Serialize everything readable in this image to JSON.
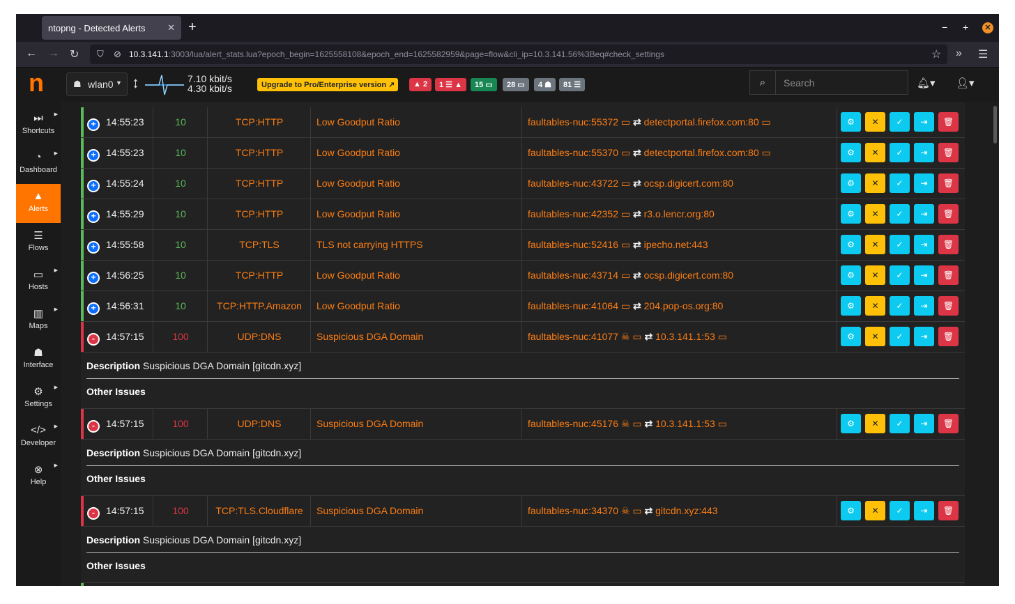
{
  "browser": {
    "tab_title": "ntopng - Detected Alerts",
    "tab_close": "✕",
    "new_tab": "+",
    "url_host": "10.3.141.1",
    "url_rest": ":3003/lua/alert_stats.lua?epoch_begin=1625558108&epoch_end=1625582959&page=flow&cli_ip=10.3.141.56%3Beq#check_settings",
    "win_min": "−",
    "win_max": "+",
    "win_close": "✕"
  },
  "header": {
    "logo": "n",
    "interface_label": "wlan0",
    "rate_up": "7.10 kbit/s",
    "rate_down": "4.30 kbit/s",
    "upgrade_label": "Upgrade to Pro/Enterprise version ↗",
    "badges": [
      {
        "label": "▲ 2",
        "color": "#dc3545"
      },
      {
        "label": "1 ☰ ▲",
        "color": "#dc3545"
      },
      {
        "label": "15 ▭",
        "color": "#198754"
      },
      {
        "label": "28 ▭",
        "color": "#6c757d"
      },
      {
        "label": "4 ☗",
        "color": "#6c757d"
      },
      {
        "label": "81 ☰",
        "color": "#6c757d"
      }
    ],
    "search_placeholder": "Search"
  },
  "sidebar": {
    "items": [
      {
        "label": "Shortcuts",
        "icon": "⏭",
        "active": false,
        "caret": true
      },
      {
        "label": "Dashboard",
        "icon": "◔",
        "active": false,
        "caret": true
      },
      {
        "label": "Alerts",
        "icon": "▲",
        "active": true,
        "caret": false
      },
      {
        "label": "Flows",
        "icon": "☰",
        "active": false,
        "caret": false
      },
      {
        "label": "Hosts",
        "icon": "▭",
        "active": false,
        "caret": true
      },
      {
        "label": "Maps",
        "icon": "▥",
        "active": false,
        "caret": true
      },
      {
        "label": "Interface",
        "icon": "☗",
        "active": false,
        "caret": false
      },
      {
        "label": "Settings",
        "icon": "⚙",
        "active": false,
        "caret": true
      },
      {
        "label": "Developer",
        "icon": "</>",
        "active": false,
        "caret": true
      },
      {
        "label": "Help",
        "icon": "⊗",
        "active": false,
        "caret": true
      }
    ]
  },
  "alerts": {
    "rows": [
      {
        "toggle": "+",
        "time": "14:55:23",
        "score": "10",
        "proto": "TCP:HTTP",
        "alert": "Low Goodput Ratio",
        "client": "faultables-nuc:55372",
        "client_skull": false,
        "server": "detectportal.firefox.com:80",
        "server_icon": true,
        "severity": "low"
      },
      {
        "toggle": "+",
        "time": "14:55:23",
        "score": "10",
        "proto": "TCP:HTTP",
        "alert": "Low Goodput Ratio",
        "client": "faultables-nuc:55370",
        "client_skull": false,
        "server": "detectportal.firefox.com:80",
        "server_icon": true,
        "severity": "low"
      },
      {
        "toggle": "+",
        "time": "14:55:24",
        "score": "10",
        "proto": "TCP:HTTP",
        "alert": "Low Goodput Ratio",
        "client": "faultables-nuc:43722",
        "client_skull": false,
        "server": "ocsp.digicert.com:80",
        "server_icon": false,
        "severity": "low"
      },
      {
        "toggle": "+",
        "time": "14:55:29",
        "score": "10",
        "proto": "TCP:HTTP",
        "alert": "Low Goodput Ratio",
        "client": "faultables-nuc:42352",
        "client_skull": false,
        "server": "r3.o.lencr.org:80",
        "server_icon": false,
        "severity": "low"
      },
      {
        "toggle": "+",
        "time": "14:55:58",
        "score": "10",
        "proto": "TCP:TLS",
        "alert": "TLS not carrying HTTPS",
        "client": "faultables-nuc:52416",
        "client_skull": false,
        "server": "ipecho.net:443",
        "server_icon": false,
        "severity": "low"
      },
      {
        "toggle": "+",
        "time": "14:56:25",
        "score": "10",
        "proto": "TCP:HTTP",
        "alert": "Low Goodput Ratio",
        "client": "faultables-nuc:43714",
        "client_skull": false,
        "server": "ocsp.digicert.com:80",
        "server_icon": false,
        "severity": "low"
      },
      {
        "toggle": "+",
        "time": "14:56:31",
        "score": "10",
        "proto": "TCP:HTTP.Amazon",
        "alert": "Low Goodput Ratio",
        "client": "faultables-nuc:41064",
        "client_skull": false,
        "server": "204.pop-os.org:80",
        "server_icon": false,
        "severity": "low"
      },
      {
        "toggle": "-",
        "time": "14:57:15",
        "score": "100",
        "proto": "UDP:DNS",
        "alert": "Suspicious DGA Domain",
        "client": "faultables-nuc:41077",
        "client_skull": true,
        "server": "10.3.141.1:53",
        "server_icon": true,
        "severity": "high",
        "description_label": "Description",
        "description": "Suspicious DGA Domain [gitcdn.xyz]",
        "other_issues": "Other Issues"
      },
      {
        "toggle": "-",
        "time": "14:57:15",
        "score": "100",
        "proto": "UDP:DNS",
        "alert": "Suspicious DGA Domain",
        "client": "faultables-nuc:45176",
        "client_skull": true,
        "server": "10.3.141.1:53",
        "server_icon": true,
        "severity": "high",
        "description_label": "Description",
        "description": "Suspicious DGA Domain [gitcdn.xyz]",
        "other_issues": "Other Issues"
      },
      {
        "toggle": "-",
        "time": "14:57:15",
        "score": "100",
        "proto": "TCP:TLS.Cloudflare",
        "alert": "Suspicious DGA Domain",
        "client": "faultables-nuc:34370",
        "client_skull": true,
        "server": "gitcdn.xyz:443",
        "server_icon": false,
        "severity": "high",
        "description_label": "Description",
        "description": "Suspicious DGA Domain [gitcdn.xyz]",
        "other_issues": "Other Issues"
      }
    ]
  }
}
